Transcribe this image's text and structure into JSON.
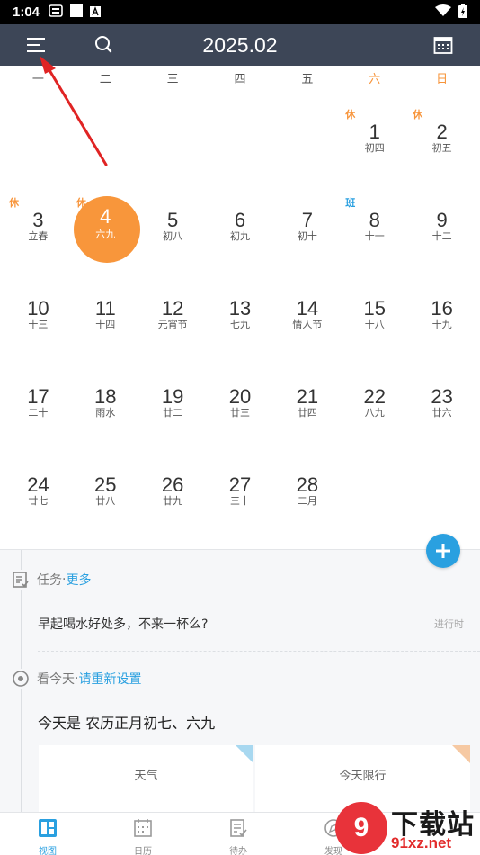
{
  "status_bar": {
    "time": "1:04"
  },
  "app_bar": {
    "title": "2025.02",
    "menu_icon": "hamburger-menu-icon",
    "search_icon": "search-icon",
    "calendar_icon": "calendar-icon"
  },
  "weekdays": [
    "一",
    "二",
    "三",
    "四",
    "五",
    "六",
    "日"
  ],
  "calendar": {
    "weeks": [
      [
        {
          "day": "",
          "lunar": "",
          "badge": ""
        },
        {
          "day": "",
          "lunar": "",
          "badge": ""
        },
        {
          "day": "",
          "lunar": "",
          "badge": ""
        },
        {
          "day": "",
          "lunar": "",
          "badge": ""
        },
        {
          "day": "",
          "lunar": "",
          "badge": ""
        },
        {
          "day": "1",
          "lunar": "初四",
          "badge": "休"
        },
        {
          "day": "2",
          "lunar": "初五",
          "badge": "休"
        }
      ],
      [
        {
          "day": "3",
          "lunar": "立春",
          "badge": "休"
        },
        {
          "day": "4",
          "lunar": "六九",
          "badge": "休",
          "today": true
        },
        {
          "day": "5",
          "lunar": "初八",
          "badge": ""
        },
        {
          "day": "6",
          "lunar": "初九",
          "badge": ""
        },
        {
          "day": "7",
          "lunar": "初十",
          "badge": ""
        },
        {
          "day": "8",
          "lunar": "十一",
          "badge": "班",
          "work": true
        },
        {
          "day": "9",
          "lunar": "十二",
          "badge": ""
        }
      ],
      [
        {
          "day": "10",
          "lunar": "十三",
          "badge": ""
        },
        {
          "day": "11",
          "lunar": "十四",
          "badge": ""
        },
        {
          "day": "12",
          "lunar": "元宵节",
          "badge": ""
        },
        {
          "day": "13",
          "lunar": "七九",
          "badge": ""
        },
        {
          "day": "14",
          "lunar": "情人节",
          "badge": ""
        },
        {
          "day": "15",
          "lunar": "十八",
          "badge": ""
        },
        {
          "day": "16",
          "lunar": "十九",
          "badge": ""
        }
      ],
      [
        {
          "day": "17",
          "lunar": "二十",
          "badge": ""
        },
        {
          "day": "18",
          "lunar": "雨水",
          "badge": ""
        },
        {
          "day": "19",
          "lunar": "廿二",
          "badge": ""
        },
        {
          "day": "20",
          "lunar": "廿三",
          "badge": ""
        },
        {
          "day": "21",
          "lunar": "廿四",
          "badge": ""
        },
        {
          "day": "22",
          "lunar": "八九",
          "badge": ""
        },
        {
          "day": "23",
          "lunar": "廿六",
          "badge": ""
        }
      ],
      [
        {
          "day": "24",
          "lunar": "廿七",
          "badge": ""
        },
        {
          "day": "25",
          "lunar": "廿八",
          "badge": ""
        },
        {
          "day": "26",
          "lunar": "廿九",
          "badge": ""
        },
        {
          "day": "27",
          "lunar": "三十",
          "badge": ""
        },
        {
          "day": "28",
          "lunar": "二月",
          "badge": ""
        },
        {
          "day": "",
          "lunar": "",
          "badge": ""
        },
        {
          "day": "",
          "lunar": "",
          "badge": ""
        }
      ]
    ]
  },
  "tasks": {
    "label": "任务",
    "separator": " · ",
    "more": "更多",
    "item_text": "早起喝水好处多，不来一杯么?",
    "item_status": "进行时"
  },
  "today_section": {
    "label": "看今天",
    "separator": " · ",
    "link": "请重新设置",
    "text": "今天是 农历正月初七、六九"
  },
  "cards": [
    {
      "label": "天气",
      "corner_color": "#a8d8f0"
    },
    {
      "label": "今天限行",
      "corner_color": "#f6c9a3"
    }
  ],
  "bottom_nav": [
    {
      "label": "视图",
      "icon": "grid-view-icon",
      "active": true
    },
    {
      "label": "日历",
      "icon": "calendar-icon"
    },
    {
      "label": "待办",
      "icon": "todo-icon"
    },
    {
      "label": "发现",
      "icon": "discover-icon"
    }
  ],
  "colors": {
    "app_bar": "#3d4657",
    "accent_orange": "#f8963b",
    "accent_blue": "#2aa0e0",
    "annotation_arrow": "#e02424"
  },
  "watermark": {
    "brand": "下载站",
    "domain": "91xz.net",
    "logo_text": "9"
  }
}
